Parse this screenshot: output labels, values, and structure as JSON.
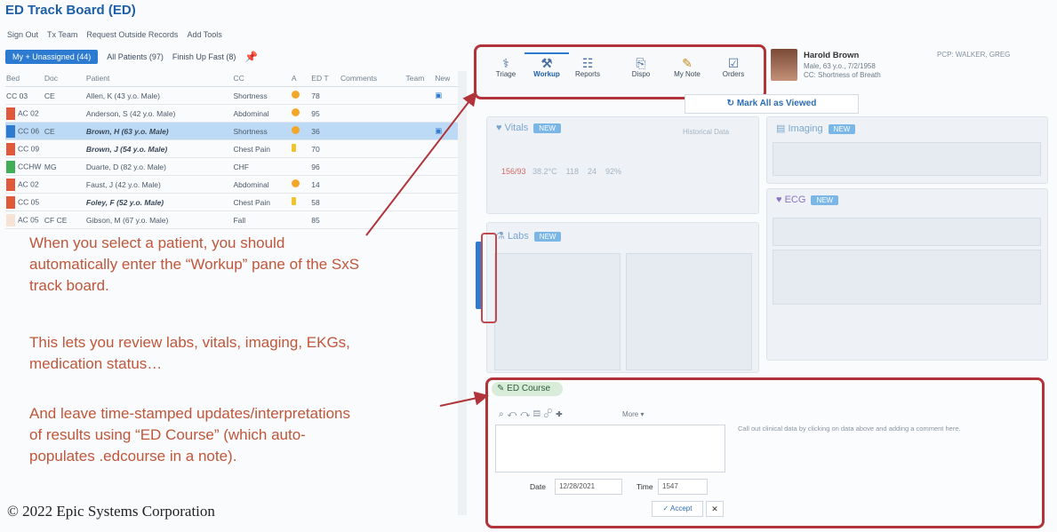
{
  "title": "ED Track Board (ED)",
  "topbar": [
    "Sign Out",
    "Tx Team",
    "Request Outside Records",
    "Add Tools"
  ],
  "filters": {
    "mine": "My + Unassigned (44)",
    "all": "All Patients (97)",
    "finish": "Finish Up Fast (8)"
  },
  "table": {
    "headers": [
      "Bed",
      "Doc",
      "Patient",
      "CC",
      "A",
      "ED T",
      "Comments",
      "Team",
      "New"
    ],
    "rows": [
      {
        "bed": "CC 03",
        "doc": "CE",
        "patient": "Allen, K (43 y.o. Male)",
        "cc": "Shortness",
        "a": "3",
        "edt": "78",
        "flag": "",
        "sel": false,
        "bold": false
      },
      {
        "bed": "AC 02",
        "doc": "",
        "patient": "Anderson, S (42 y.o. Male)",
        "cc": "Abdominal",
        "a": "3",
        "edt": "95",
        "flag": "#e05a3a",
        "sel": false,
        "bold": false
      },
      {
        "bed": "CC 06",
        "doc": "CE",
        "patient": "Brown, H (63 y.o. Male)",
        "cc": "Shortness",
        "a": "3",
        "edt": "36",
        "flag": "#2d7bd1",
        "sel": true,
        "bold": true
      },
      {
        "bed": "CC 09",
        "doc": "",
        "patient": "Brown, J (54 y.o. Male)",
        "cc": "Chest Pain",
        "a": "2",
        "edt": "70",
        "flag": "#e05a3a",
        "sel": false,
        "bold": true
      },
      {
        "bed": "CCHW",
        "doc": "MG",
        "patient": "Duarte, D (82 y.o. Male)",
        "cc": "CHF",
        "a": "",
        "edt": "96",
        "flag": "#3fae57",
        "sel": false,
        "bold": false
      },
      {
        "bed": "AC 02",
        "doc": "",
        "patient": "Faust, J (42 y.o. Male)",
        "cc": "Abdominal",
        "a": "3",
        "edt": "14",
        "flag": "#e05a3a",
        "sel": false,
        "bold": false
      },
      {
        "bed": "CC 05",
        "doc": "",
        "patient": "Foley, F (52 y.o. Male)",
        "cc": "Chest Pain",
        "a": "2",
        "edt": "58",
        "flag": "#e05a3a",
        "sel": false,
        "bold": true
      },
      {
        "bed": "AC 05",
        "doc": "CF CE",
        "patient": "Gibson, M (67 y.o. Male)",
        "cc": "Fall",
        "a": "",
        "edt": "85",
        "flag": "#f6e3d6",
        "sel": false,
        "bold": false
      }
    ]
  },
  "notes": {
    "p1": [
      "When you select a patient, you should",
      "automatically enter the “Workup” pane of the SxS",
      "track board."
    ],
    "p2": [
      "This lets you review labs, vitals, imaging, EKGs,",
      "medication status…"
    ],
    "p3": [
      "And leave time-stamped updates/interpretations",
      "of results using “ED Course” (which auto-",
      "populates .edcourse in a note)."
    ]
  },
  "copyright": "© 2022 Epic Systems Corporation",
  "tabs": [
    "Triage",
    "Workup",
    "Dispo",
    "Orders"
  ],
  "tabs_full": [
    {
      "label": "Triage",
      "icon": "triage-icon",
      "glyph": "⚕"
    },
    {
      "label": "Workup",
      "icon": "workup-icon",
      "glyph": "⚒"
    },
    {
      "label": "Reports",
      "icon": "reports-icon",
      "glyph": "☷"
    },
    {
      "label": "Dispo",
      "icon": "dispo-icon",
      "glyph": "⎘"
    },
    {
      "label": "My Note",
      "icon": "note-icon",
      "glyph": "✎"
    },
    {
      "label": "Orders",
      "icon": "orders-icon",
      "glyph": "☑"
    }
  ],
  "patient": {
    "name": "Harold Brown",
    "info": "Male, 63 y.o., 7/2/1958",
    "cc": "CC: Shortness of Breath",
    "pcp": "PCP: WALKER, GREG"
  },
  "mark_all": "Mark All as Viewed",
  "cards": {
    "vitals": "Vitals",
    "imaging": "Imaging",
    "labs": "Labs",
    "ecg": "ECG",
    "new": "NEW"
  },
  "ed_course": {
    "tab": "ED Course",
    "more": "More",
    "hint": "Call out clinical data by clicking on data above and adding a comment here.",
    "date_label": "Date",
    "date": "12/28/2021",
    "time_label": "Time",
    "time": "1547",
    "accept": "Accept"
  },
  "colors": {
    "accent": "#2d7bd1",
    "annotation": "#b0343a",
    "note_text": "#c0563a"
  }
}
